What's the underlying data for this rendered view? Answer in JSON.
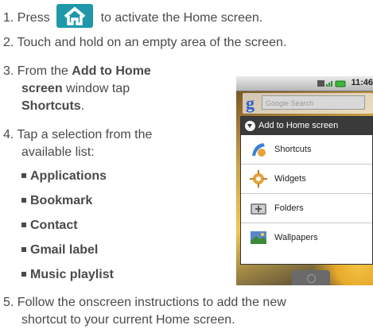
{
  "steps": [
    {
      "num": "1.",
      "before": "Press",
      "after": "to activate the Home screen."
    },
    {
      "num": "2.",
      "text": "Touch and hold on an empty area of the screen."
    },
    {
      "num": "3.",
      "lines": [
        "From the",
        "Add to Home",
        "screen",
        "window tap",
        "Shortcuts",
        "."
      ]
    },
    {
      "num": "4.",
      "lines": [
        "Tap a selection from the",
        "available list:"
      ]
    },
    {
      "num": "5.",
      "lines": [
        "Follow the onscreen instructions to add the new",
        "shortcut to your current Home screen."
      ]
    }
  ],
  "list_options": [
    "Applications",
    "Bookmark",
    "Contact",
    "Gmail label",
    "Music playlist"
  ],
  "phone": {
    "time": "11:46",
    "search_placeholder": "Google Search",
    "dialog_title": "Add to Home screen",
    "items": [
      "Shortcuts",
      "Widgets",
      "Folders",
      "Wallpapers"
    ]
  },
  "icons": {
    "home_key": "home-key-icon",
    "dialog": "chevron-down-circle-icon",
    "items": [
      "shortcuts-icon",
      "widgets-icon",
      "folders-icon",
      "wallpapers-icon"
    ]
  },
  "colors": {
    "text": "#4a4a4a",
    "home_key": "#1f98ab"
  }
}
